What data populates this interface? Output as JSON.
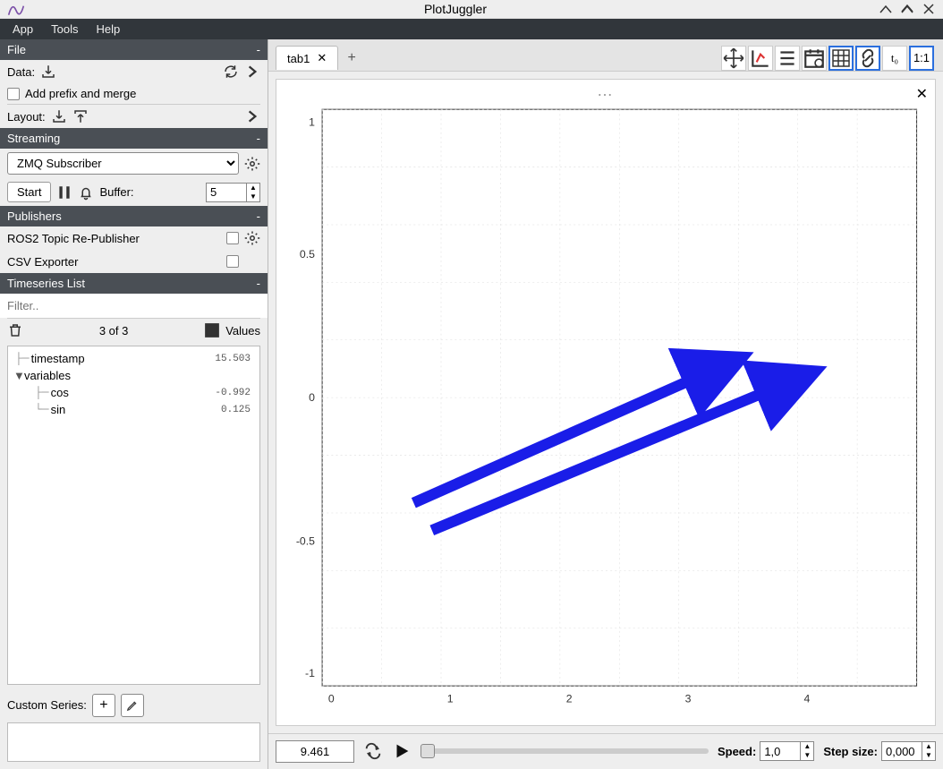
{
  "window": {
    "title": "PlotJuggler"
  },
  "menubar": {
    "app": "App",
    "tools": "Tools",
    "help": "Help"
  },
  "file": {
    "header": "File",
    "data_label": "Data:",
    "addprefix_label": "Add prefix and merge",
    "layout_label": "Layout:"
  },
  "streaming": {
    "header": "Streaming",
    "source": "ZMQ Subscriber",
    "start_label": "Start",
    "buffer_label": "Buffer:",
    "buffer_value": "5"
  },
  "publishers": {
    "header": "Publishers",
    "ros2": "ROS2 Topic Re-Publisher",
    "csv": "CSV Exporter"
  },
  "timeseries": {
    "header": "Timeseries List",
    "filter_placeholder": "Filter..",
    "count": "3 of 3",
    "values_label": "Values",
    "items": {
      "timestamp_label": "timestamp",
      "timestamp_val": "15.503",
      "variables_label": "variables",
      "cos_label": "cos",
      "cos_val": "-0.992",
      "sin_label": "sin",
      "sin_val": "0.125"
    }
  },
  "custom": {
    "label": "Custom Series:"
  },
  "tabs": {
    "tab1": "tab1"
  },
  "toolbar_icons": {
    "move": "move-icon",
    "axes": "axes-icon",
    "list": "list-icon",
    "calendar": "calendar-icon",
    "grid": "grid-icon",
    "link": "link-icon",
    "t0": "t₀",
    "ratio": "1:1"
  },
  "plot": {
    "y_ticks": [
      "1",
      "0.5",
      "0",
      "-0.5",
      "-1"
    ],
    "x_ticks": [
      "0",
      "1",
      "2",
      "3",
      "4"
    ]
  },
  "bottombar": {
    "time": "9.461",
    "speed_label": "Speed:",
    "speed_value": "1,0",
    "step_label": "Step size:",
    "step_value": "0,000"
  },
  "chart_data": {
    "type": "line",
    "title": "",
    "xlabel": "",
    "ylabel": "",
    "xlim": [
      0,
      5
    ],
    "ylim": [
      -1.1,
      1.1
    ],
    "x_ticks": [
      0,
      1,
      2,
      3,
      4
    ],
    "y_ticks": [
      -1,
      -0.5,
      0,
      0.5,
      1
    ],
    "series": [],
    "note": "plot area is empty (no curves drawn)"
  }
}
